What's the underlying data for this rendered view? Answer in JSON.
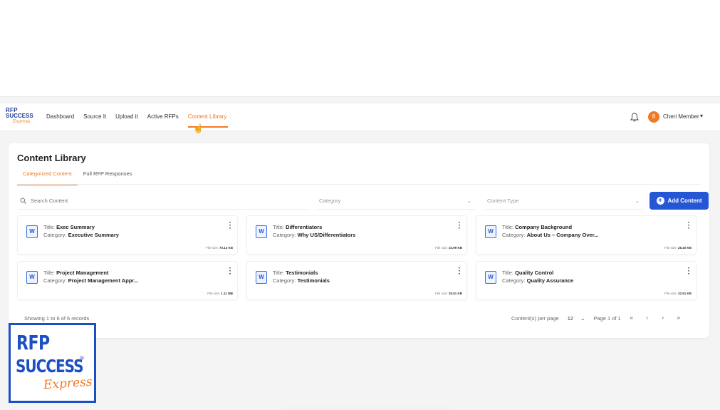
{
  "brand": {
    "line1": "RFP",
    "line2": "SUCCESS",
    "line3": "Express"
  },
  "nav": {
    "items": [
      "Dashboard",
      "Source It",
      "Upload it",
      "Active RFPs",
      "Content Library"
    ]
  },
  "user": {
    "initial": "8",
    "name": "Cheri Member"
  },
  "page": {
    "title": "Content Library",
    "tabs": [
      "Categorized Content",
      "Full RFP Responses"
    ]
  },
  "filters": {
    "search_placeholder": "Search Content",
    "category_placeholder": "Category",
    "type_placeholder": "Content Type",
    "add_label": "Add Content"
  },
  "labels": {
    "title": "Title:",
    "category": "Category:",
    "file_size": "File size:"
  },
  "items": [
    {
      "title": "Exec Summary",
      "category": "Executive Summary",
      "size": "70.13 KB"
    },
    {
      "title": "Differentiators",
      "category": "Why US/Differentiators",
      "size": "33.99 KB"
    },
    {
      "title": "Company Background",
      "category": "About Us – Company Over...",
      "size": "28.40 KB"
    },
    {
      "title": "Project Management",
      "category": "Project Management Appr...",
      "size": "1.11 MB"
    },
    {
      "title": "Testimonials",
      "category": "Testimonials",
      "size": "29.51 KB"
    },
    {
      "title": "Quality Control",
      "category": "Quality Assurance",
      "size": "32.51 KB"
    }
  ],
  "pagination": {
    "summary": "Showing 1 to 6 of 6 records",
    "per_page_label": "Content(s) per page",
    "per_page_value": "12",
    "page_label": "Page 1 of 1"
  },
  "logo": {
    "line1": "RFP",
    "line2": "SUCCESS",
    "line3": "Express",
    "mark": "®"
  },
  "colors": {
    "accent": "#f07a24",
    "primary": "#2456d6",
    "brand_blue": "#1d4fc4"
  }
}
